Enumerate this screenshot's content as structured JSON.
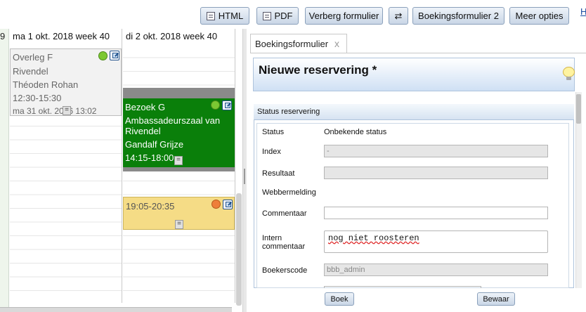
{
  "toolbar": {
    "html_label": "HTML",
    "pdf_label": "PDF",
    "hide_form_label": "Verberg formulier",
    "swap_symbol": "⇄",
    "form2_label": "Boekingsformulier 2",
    "more_label": "Meer opties",
    "edge_link": "H"
  },
  "calendar": {
    "left_cut_text": "9",
    "days": [
      {
        "header": "ma 1 okt. 2018 week 40"
      },
      {
        "header": "di 2 okt. 2018 week 40"
      }
    ],
    "events": {
      "overleg": {
        "title": "Overleg F",
        "location": "Rivendel",
        "person": "Théoden Rohan",
        "time": "12:30-15:30",
        "modified": "ma 31 okt. 2016 13:02",
        "status_color": "#7cc832"
      },
      "bezoek": {
        "title": "Bezoek G",
        "location": "Ambassadeurszaal van Rivendel",
        "person": "Gandalf Grijze",
        "time": "14:15-18:00",
        "status_color": "#7cc832",
        "bg_color": "#0a7f0a"
      },
      "yellow": {
        "time": "19:05-20:35",
        "status_color": "#ee7f3a",
        "bg_color": "#f5dc86"
      }
    },
    "grip_symbol": "="
  },
  "form": {
    "tab_label": "Boekingsformulier",
    "tab_close": "x",
    "title": "Nieuwe reservering *",
    "section_title": "Status reservering",
    "fields": {
      "status_label": "Status",
      "status_value": "Onbekende status",
      "index_label": "Index",
      "index_value": "-",
      "resultaat_label": "Resultaat",
      "webbermelding_label": "Webbermelding",
      "commentaar_label": "Commentaar",
      "intern_label": "Intern commentaar",
      "intern_value": "nog niet roosteren",
      "boekerscode_label": "Boekerscode",
      "boekerscode_value": "bbb_admin"
    },
    "book_label": "Boek",
    "save_label": "Bewaar"
  }
}
